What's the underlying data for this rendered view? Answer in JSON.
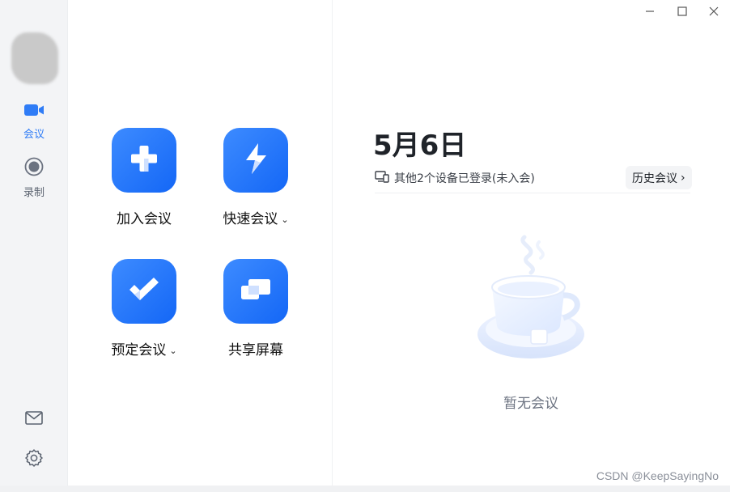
{
  "sidebar": {
    "items": [
      {
        "label": "会议",
        "icon": "video-camera-icon",
        "active": true
      },
      {
        "label": "录制",
        "icon": "record-icon",
        "active": false
      }
    ],
    "bottom": [
      {
        "icon": "mail-icon"
      },
      {
        "icon": "gear-icon"
      }
    ]
  },
  "actions": [
    {
      "label": "加入会议",
      "icon": "plus-icon",
      "has_dropdown": false
    },
    {
      "label": "快速会议",
      "icon": "lightning-icon",
      "has_dropdown": true
    },
    {
      "label": "预定会议",
      "icon": "checkmark-icon",
      "has_dropdown": true
    },
    {
      "label": "共享屏幕",
      "icon": "screen-share-icon",
      "has_dropdown": false
    }
  ],
  "main": {
    "date": "5月6日",
    "devices_text": "其他2个设备已登录(未入会)",
    "history_label": "历史会议",
    "empty_text": "暂无会议"
  },
  "window_controls": [
    "minimize-icon",
    "maximize-icon",
    "close-icon"
  ],
  "watermark": "CSDN @KeepSayingNo",
  "colors": {
    "accent": "#2f7cf6",
    "tile_gradient_start": "#3d8bff",
    "tile_gradient_end": "#1467f6",
    "sidebar_bg": "#f3f4f6"
  }
}
